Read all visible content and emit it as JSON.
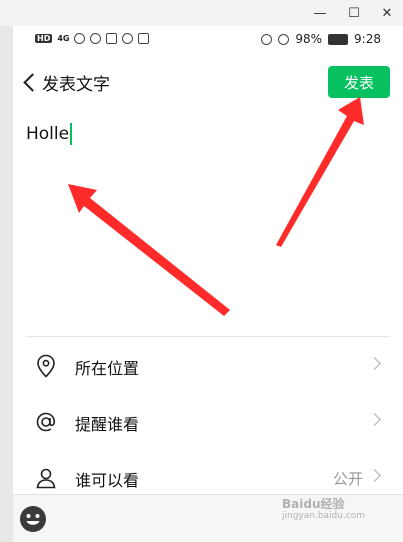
{
  "window": {
    "minimize_glyph": "—",
    "maximize_glyph": "☐",
    "close_glyph": "✕"
  },
  "status_bar": {
    "hd": "HD",
    "net": "4G",
    "battery": "98%",
    "time": "9:28"
  },
  "header": {
    "title": "发表文字",
    "publish_label": "发表"
  },
  "compose": {
    "text": "Holle"
  },
  "options": [
    {
      "label": "所在位置",
      "icon": "location-pin-icon",
      "value": ""
    },
    {
      "label": "提醒谁看",
      "icon": "at-icon",
      "value": ""
    },
    {
      "label": "谁可以看",
      "icon": "person-icon",
      "value": "公开"
    }
  ],
  "watermark": {
    "text": "Baidu经验",
    "sub": "jingyan.baidu.com"
  },
  "annotation_color": "#ff2a2a",
  "accent_color": "#07c160"
}
